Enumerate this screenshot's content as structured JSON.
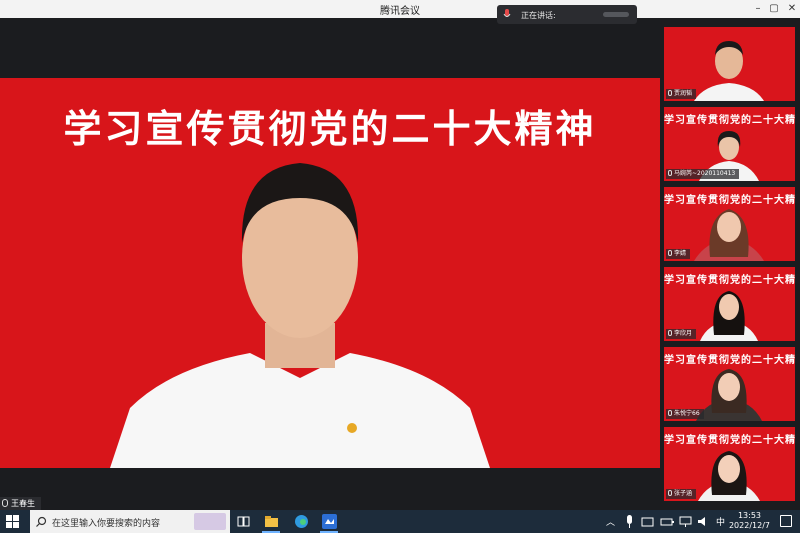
{
  "window": {
    "title": "腾讯会议",
    "minimize": "–",
    "maximize": "▢",
    "close": "✕"
  },
  "speaking_indicator": {
    "label": "正在讲话:"
  },
  "main_video": {
    "banner": "学习宣传贯彻党的二十大精神",
    "speaker_name": "王春生",
    "menu_glyph": "☰"
  },
  "participants": [
    {
      "name": "贾润韬",
      "slogan": ""
    },
    {
      "name": "马婉芮~2020110413",
      "slogan": "学习宣传贯彻党的二十大精神"
    },
    {
      "name": "李婧",
      "slogan": "学习宣传贯彻党的二十大精神"
    },
    {
      "name": "李欣月",
      "slogan": "学习宣传贯彻党的二十大精神"
    },
    {
      "name": "朱悦宁66",
      "slogan": "学习宣传贯彻党的二十大精神"
    },
    {
      "name": "张子涵",
      "slogan": "学习宣传贯彻党的二十大精神"
    }
  ],
  "taskbar": {
    "search_placeholder": "在这里输入你要搜索的内容",
    "ime": "中",
    "time": "13:53",
    "date": "2022/12/7"
  },
  "colors": {
    "banner_red": "#d8151a",
    "taskbar": "#1d2c3b"
  }
}
